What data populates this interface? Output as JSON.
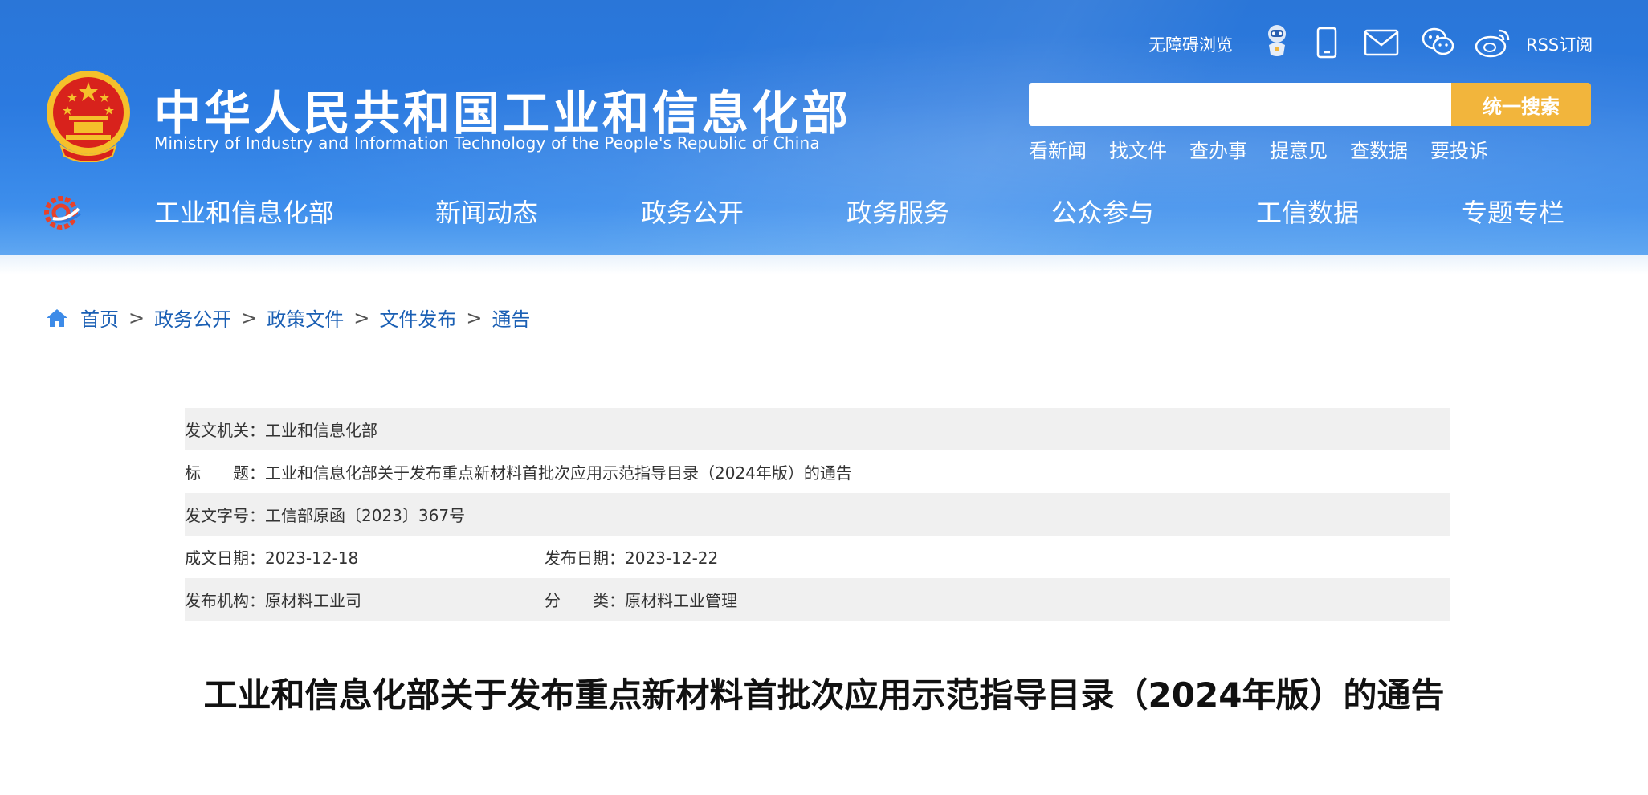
{
  "site": {
    "title": "中华人民共和国工业和信息化部",
    "subtitle": "Ministry of Industry and Information Technology of the People's Republic of China"
  },
  "top_links": {
    "accessibility": "无障碍浏览",
    "rss": "RSS订阅"
  },
  "search": {
    "value": "",
    "button": "统一搜索"
  },
  "quick_links": [
    "看新闻",
    "找文件",
    "查办事",
    "提意见",
    "查数据",
    "要投诉"
  ],
  "nav": [
    "工业和信息化部",
    "新闻动态",
    "政务公开",
    "政务服务",
    "公众参与",
    "工信数据",
    "专题专栏"
  ],
  "breadcrumb": [
    "首页",
    "政务公开",
    "政策文件",
    "文件发布",
    "通告"
  ],
  "meta": {
    "issuer_label": "发文机关：",
    "issuer": "工业和信息化部",
    "title_label": "标　　题：",
    "title": "工业和信息化部关于发布重点新材料首批次应用示范指导目录（2024年版）的通告",
    "docno_label": "发文字号：",
    "docno": "工信部原函〔2023〕367号",
    "written_label": "成文日期：",
    "written": "2023-12-18",
    "published_label": "发布日期：",
    "published": "2023-12-22",
    "org_label": "发布机构：",
    "org": "原材料工业司",
    "category_label": "分　　类：",
    "category": "原材料工业管理"
  },
  "doc_title": "工业和信息化部关于发布重点新材料首批次应用示范指导目录（2024年版）的通告",
  "colors": {
    "header_blue": "#2b7ae0",
    "search_button": "#f2b53c",
    "breadcrumb_link": "#1a5fb4"
  }
}
